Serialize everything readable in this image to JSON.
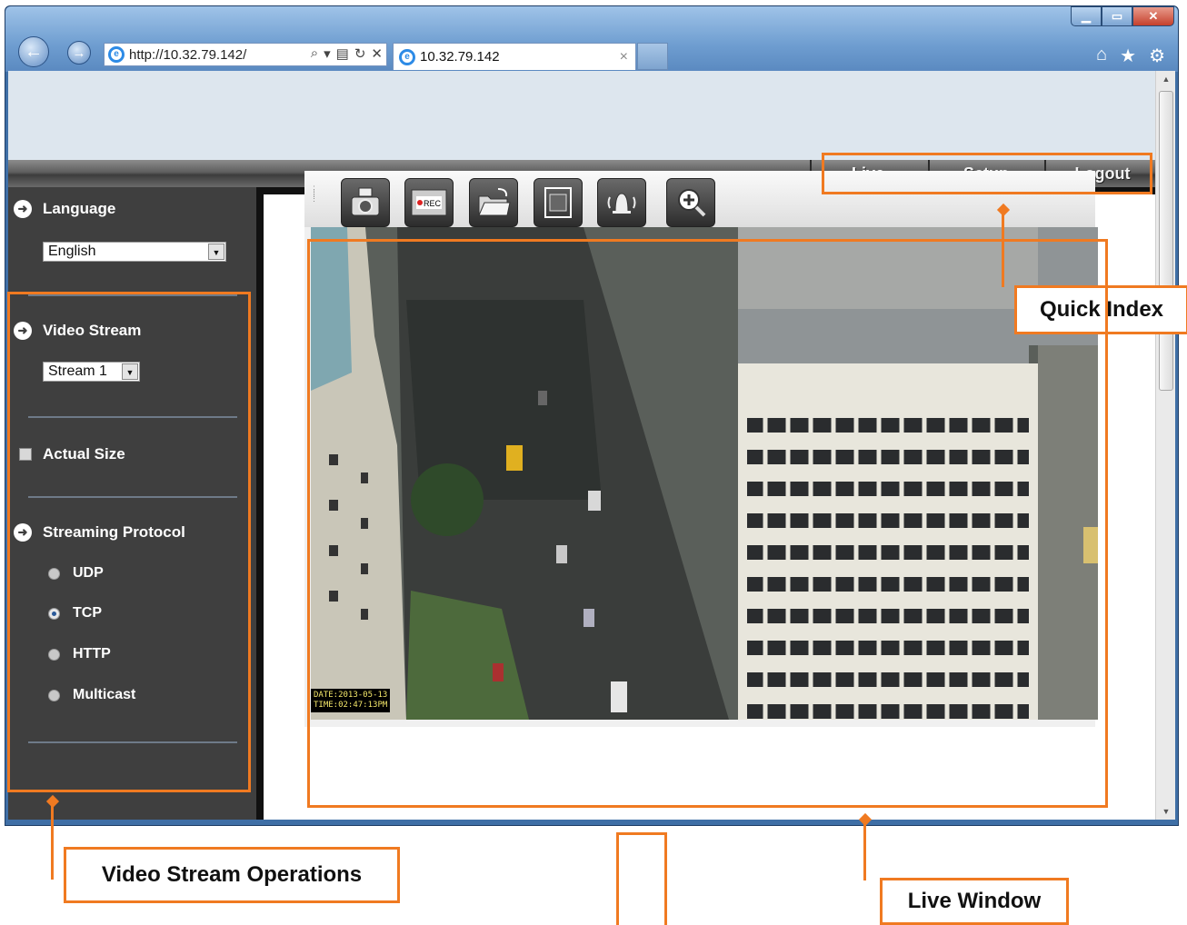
{
  "browser": {
    "address_url": "http://10.32.79.142/",
    "tab_title": "10.32.79.142",
    "window_controls": [
      "minimize",
      "maximize",
      "close"
    ],
    "toolbar_icons": [
      "home-icon",
      "favorites-star-icon",
      "settings-gear-icon"
    ]
  },
  "menu": {
    "items": [
      "Live",
      "Setup",
      "Logout"
    ],
    "active": "Live"
  },
  "sidebar": {
    "language_label": "Language",
    "language_value": "English",
    "video_stream_label": "Video Stream",
    "video_stream_value": "Stream 1",
    "actual_size_label": "Actual Size",
    "actual_size_checked": false,
    "streaming_protocol_label": "Streaming Protocol",
    "protocols": [
      {
        "label": "UDP",
        "selected": false
      },
      {
        "label": "TCP",
        "selected": true
      },
      {
        "label": "HTTP",
        "selected": false
      },
      {
        "label": "Multicast",
        "selected": false
      }
    ]
  },
  "live_window": {
    "toolbar_buttons": [
      "snapshot-camera-icon",
      "record-icon",
      "folder-icon",
      "fullscreen-icon",
      "alarm-bell-icon",
      "zoom-in-icon"
    ],
    "rec_text": "REC",
    "osd_date": "DATE:2013-05-13",
    "osd_time": "TIME:02:47:13PM"
  },
  "annotations": {
    "quick_index": "Quick Index",
    "video_stream_operations": "Video Stream Operations",
    "live_window": "Live Window"
  },
  "colors": {
    "annotation_orange": "#f07a21",
    "sidebar_bg": "#3f3f3f"
  }
}
